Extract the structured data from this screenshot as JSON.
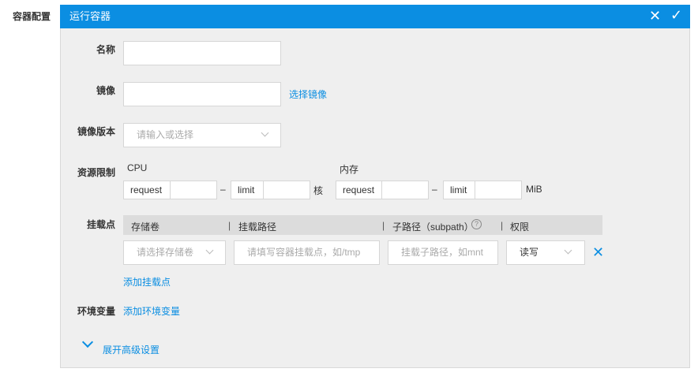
{
  "section_label": "容器配置",
  "panel": {
    "title": "运行容器"
  },
  "form": {
    "name_label": "名称",
    "image_label": "镜像",
    "select_image": "选择镜像",
    "version_label": "镜像版本",
    "version_placeholder": "请输入或选择",
    "resource_label": "资源限制",
    "cpu_label": "CPU",
    "memory_label": "内存",
    "request": "request",
    "limit": "limit",
    "dash": "–",
    "cpu_unit": "核",
    "mem_unit": "MiB",
    "mount_label": "挂载点",
    "mount_headers": [
      "存储卷",
      "挂载路径",
      "子路径（subpath）",
      "权限"
    ],
    "volume_placeholder": "请选择存储卷",
    "path_placeholder": "请填写容器挂载点，如/tmp",
    "subpath_placeholder": "挂载子路径，如mnt",
    "permission": "读写",
    "add_mount": "添加挂载点",
    "env_label": "环境变量",
    "add_env": "添加环境变量",
    "advanced": "展开高级设置"
  }
}
